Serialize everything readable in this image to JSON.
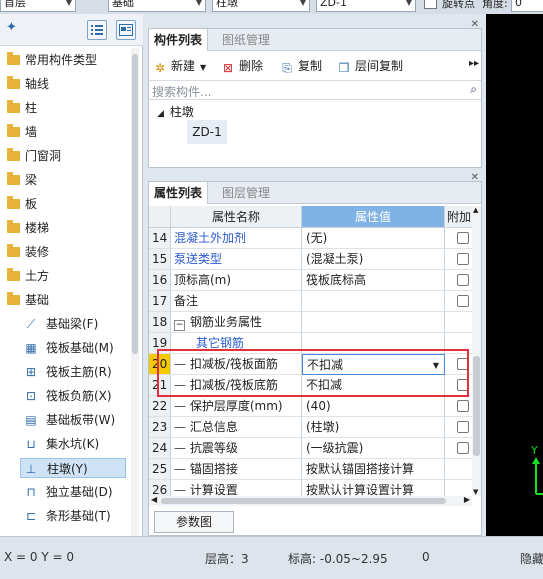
{
  "topbar": {
    "floor_select": "首层",
    "category_select": "基础",
    "type_select": "柱墩",
    "component_select": "ZD-1",
    "rotate_label": "旋转点",
    "angle_label": "角度:",
    "angle_value": "0"
  },
  "left_panel": {
    "tree": [
      {
        "label": "常用构件类型"
      },
      {
        "label": "轴线"
      },
      {
        "label": "柱"
      },
      {
        "label": "墙"
      },
      {
        "label": "门窗洞"
      },
      {
        "label": "梁"
      },
      {
        "label": "板"
      },
      {
        "label": "楼梯"
      },
      {
        "label": "装修"
      },
      {
        "label": "土方"
      },
      {
        "label": "基础"
      }
    ],
    "foundation_children": [
      {
        "label": "基础梁(F)",
        "icon": "beam-icon"
      },
      {
        "label": "筏板基础(M)",
        "icon": "raft-foundation-icon"
      },
      {
        "label": "筏板主筋(R)",
        "icon": "rebar-grid-icon"
      },
      {
        "label": "筏板负筋(X)",
        "icon": "negative-rebar-icon"
      },
      {
        "label": "基础板带(W)",
        "icon": "slab-strip-icon"
      },
      {
        "label": "集水坑(K)",
        "icon": "sump-icon"
      },
      {
        "label": "柱墩(Y)",
        "icon": "column-pier-icon",
        "selected": true
      },
      {
        "label": "独立基础(D)",
        "icon": "isolated-footing-icon"
      },
      {
        "label": "条形基础(T)",
        "icon": "strip-footing-icon"
      }
    ]
  },
  "component_panel": {
    "tab_active": "构件列表",
    "tab_other": "图纸管理",
    "new_label": "新建",
    "delete_label": "删除",
    "copy_label": "复制",
    "floor_copy_label": "层间复制",
    "search_placeholder": "搜索构件...",
    "tree_root": "柱墩",
    "tree_child": "ZD-1"
  },
  "property_panel": {
    "tab_active": "属性列表",
    "tab_other": "图层管理",
    "col_name": "属性名称",
    "col_value": "属性值",
    "col_extra": "附加",
    "rows": [
      {
        "num": "14",
        "name": "混凝土外加剂",
        "value": "(无)"
      },
      {
        "num": "15",
        "name": "泵送类型",
        "value": "(混凝土泵)"
      },
      {
        "num": "16",
        "name": "顶标高(m)",
        "value": "筏板底标高"
      },
      {
        "num": "17",
        "name": "备注",
        "value": ""
      },
      {
        "num": "18",
        "name": "钢筋业务属性",
        "value": ""
      },
      {
        "num": "19",
        "name": "其它钢筋",
        "value": ""
      },
      {
        "num": "20",
        "name": "扣减板/筏板面筋",
        "value": "不扣减"
      },
      {
        "num": "21",
        "name": "扣减板/筏板底筋",
        "value": "不扣减"
      },
      {
        "num": "22",
        "name": "保护层厚度(mm)",
        "value": "(40)"
      },
      {
        "num": "23",
        "name": "汇总信息",
        "value": "(柱墩)"
      },
      {
        "num": "24",
        "name": "抗震等级",
        "value": "(一级抗震)"
      },
      {
        "num": "25",
        "name": "锚固搭接",
        "value": "按默认锚固搭接计算"
      },
      {
        "num": "26",
        "name": "计算设置",
        "value": "按默认计算设置计算"
      }
    ],
    "param_button": "参数图"
  },
  "statusbar": {
    "coords": "X = 0 Y = 0",
    "floor_height": "层高：3",
    "elevation": "标高: -0.05~2.95",
    "count": "0",
    "hide_label": "隐藏"
  }
}
